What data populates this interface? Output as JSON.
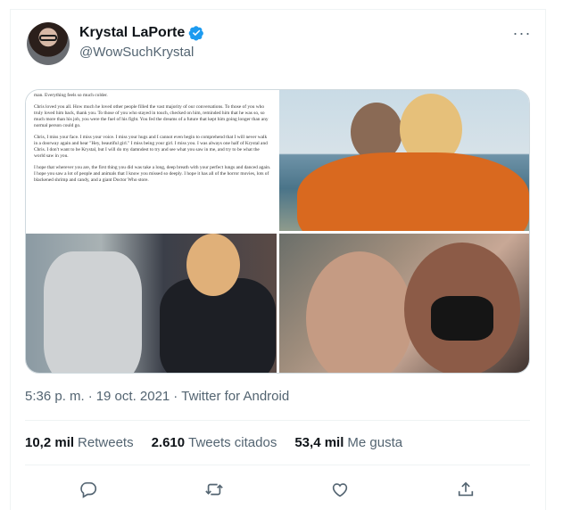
{
  "tweet": {
    "author_name": "Krystal LaPorte",
    "handle": "@WowSuchKrystal",
    "more_label": "···",
    "timestamp": "5:36 p. m.",
    "date": "19 oct. 2021",
    "source": "Twitter for Android",
    "dot": "·",
    "stats": {
      "retweets_count": "10,2 mil",
      "retweets_label": "Retweets",
      "quotes_count": "2.610",
      "quotes_label": "Tweets citados",
      "likes_count": "53,4 mil",
      "likes_label": "Me gusta"
    }
  },
  "media": {
    "document_lines": [
      "man. Everything feels so much colder.",
      "Chris loved you all. How much he loved other people filled the vast majority of our conversations. To those of you who truly loved him back, thank you. To those of you who stayed in touch, checked on him, reminded him that he was so, so much more than his job, you were the fuel of his fight. You fed the dreams of a future that kept him going longer than any normal person could go.",
      "Chris, I miss your face. I miss your voice. I miss your hugs and I cannot even begin to comprehend that I will never walk in a doorway again and hear \"Hey, beautiful girl.\" I miss being your girl. I miss you. I was always one half of Krystal and Chris. I don't want to be Krystal, but I will do my damndest to try and see what you saw in me, and try to be what the world saw in you.",
      "I hope that wherever you are, the first thing you did was take a long, deep breath with your perfect lungs and danced again. I hope you saw a lot of people and animals that I know you missed so deeply. I hope it has all of the horror movies, lots of blackened shrimp and candy, and a giant Doctor Who store."
    ]
  },
  "colors": {
    "verified": "#1d9bf0",
    "secondary_text": "#536471",
    "primary_text": "#0f1419"
  },
  "icons": [
    "verified-badge-icon",
    "more-icon",
    "reply-icon",
    "retweet-icon",
    "like-icon",
    "share-icon"
  ]
}
